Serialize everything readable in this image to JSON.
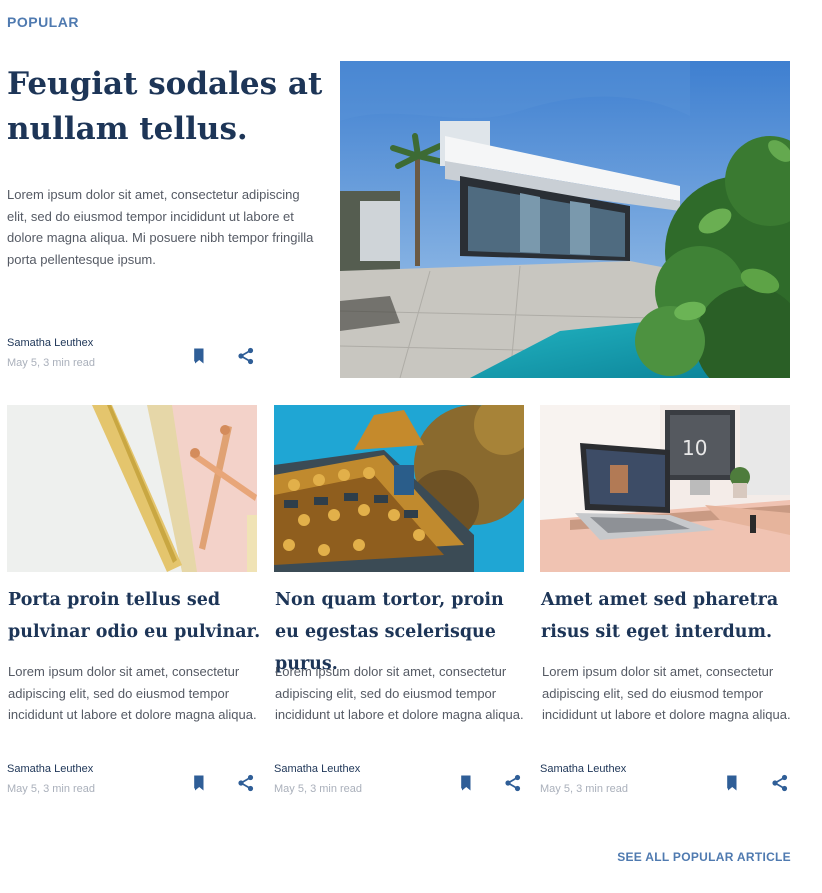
{
  "section": {
    "label": "POPULAR"
  },
  "featured": {
    "title": "Feugiat sodales at nullam tellus.",
    "excerpt": "Lorem ipsum dolor sit amet, consectetur adipiscing elit, sed do eiusmod tempor incididunt ut labore et dolore magna aliqua. Mi posuere nibh tempor fringilla porta pellentesque ipsum.",
    "author": "Samatha Leuthex",
    "date": "May 5, 3 min read"
  },
  "cards": [
    {
      "title": "Porta proin tellus sed pulvinar odio eu pulvinar.",
      "excerpt": "Lorem ipsum dolor sit amet, consectetur adipiscing elit, sed do eiusmod tempor incididunt ut labore et dolore magna aliqua.",
      "author": "Samatha Leuthex",
      "date": "May 5, 3 min read"
    },
    {
      "title": "Non quam tortor, proin eu egestas scelerisque purus.",
      "excerpt": "Lorem ipsum dolor sit amet, consectetur adipiscing elit, sed do eiusmod tempor incididunt ut labore et dolore magna aliqua.",
      "author": "Samatha Leuthex",
      "date": "May 5, 3 min read"
    },
    {
      "title": "Amet amet sed pharetra risus sit eget interdum.",
      "excerpt": "Lorem ipsum dolor sit amet, consectetur adipiscing elit, sed do eiusmod tempor incididunt ut labore et dolore magna aliqua.",
      "author": "Samatha Leuthex",
      "date": "May 5, 3 min read"
    }
  ],
  "footer": {
    "see_all_label": "SEE ALL POPULAR ARTICLE"
  },
  "icons": {
    "bookmark": "bookmark-icon",
    "share": "share-icon"
  },
  "colors": {
    "accent": "#4f7ab0",
    "heading": "#1d3557",
    "icon": "#2f5e97"
  }
}
